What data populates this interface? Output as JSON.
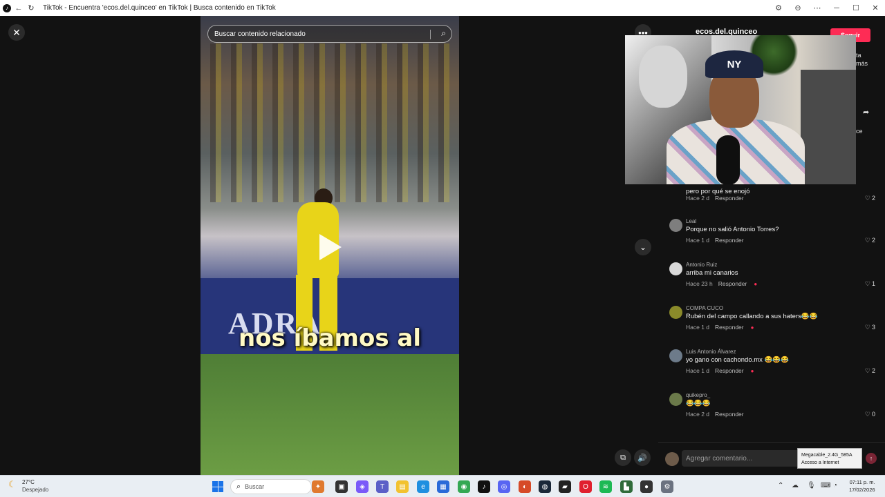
{
  "browser": {
    "title": "TikTok - Encuentra 'ecos.del.quinceo' en TikTok | Busca contenido en TikTok"
  },
  "video": {
    "search_placeholder": "Buscar contenido relacionado",
    "caption": "nos íbamos al",
    "banner_text": "ADRAS"
  },
  "author": {
    "username": "ecos.del.quinceo",
    "follow_label": "Seguir",
    "partial_lines": [
      "ta",
      "más",
      "ce"
    ]
  },
  "webcam": {
    "cap_logo": "NY"
  },
  "comments": [
    {
      "name": "",
      "text": "pero por qué se enojó",
      "time": "Hace 2 d",
      "reply": "Responder",
      "likes": "2",
      "badge": ""
    },
    {
      "name": "Leal",
      "text": "Porque no salió Antonio Torres?",
      "time": "Hace 1 d",
      "reply": "Responder",
      "likes": "2",
      "badge": ""
    },
    {
      "name": "Antonio Ruiz",
      "text": "arriba mi canarios",
      "time": "Hace 23 h",
      "reply": "Responder",
      "likes": "1",
      "badge": "●"
    },
    {
      "name": "COMPA CUCO",
      "text": "Rubén del campo callando a sus haters😂😂",
      "time": "Hace 1 d",
      "reply": "Responder",
      "likes": "3",
      "badge": "●"
    },
    {
      "name": "Luis Antonio Álvarez",
      "text": "yo gano con cachondo.mx 😂😂😂",
      "time": "Hace 1 d",
      "reply": "Responder",
      "likes": "2",
      "badge": "●"
    },
    {
      "name": "quikepro_",
      "text": "😂😂😂",
      "time": "Hace 2 d",
      "reply": "Responder",
      "likes": "0",
      "badge": ""
    }
  ],
  "comment_input": {
    "placeholder": "Agregar comentario..."
  },
  "wifi_tooltip": {
    "network": "Megacable_2.4G_585A",
    "status": "Acceso a Internet"
  },
  "taskbar": {
    "temperature": "27°C",
    "condition": "Despejado",
    "search_label": "Buscar",
    "time": "07:11 p. m.",
    "date": "17/02/2026"
  },
  "colors": {
    "accent": "#fe2c55",
    "panel_bg": "#121212"
  }
}
